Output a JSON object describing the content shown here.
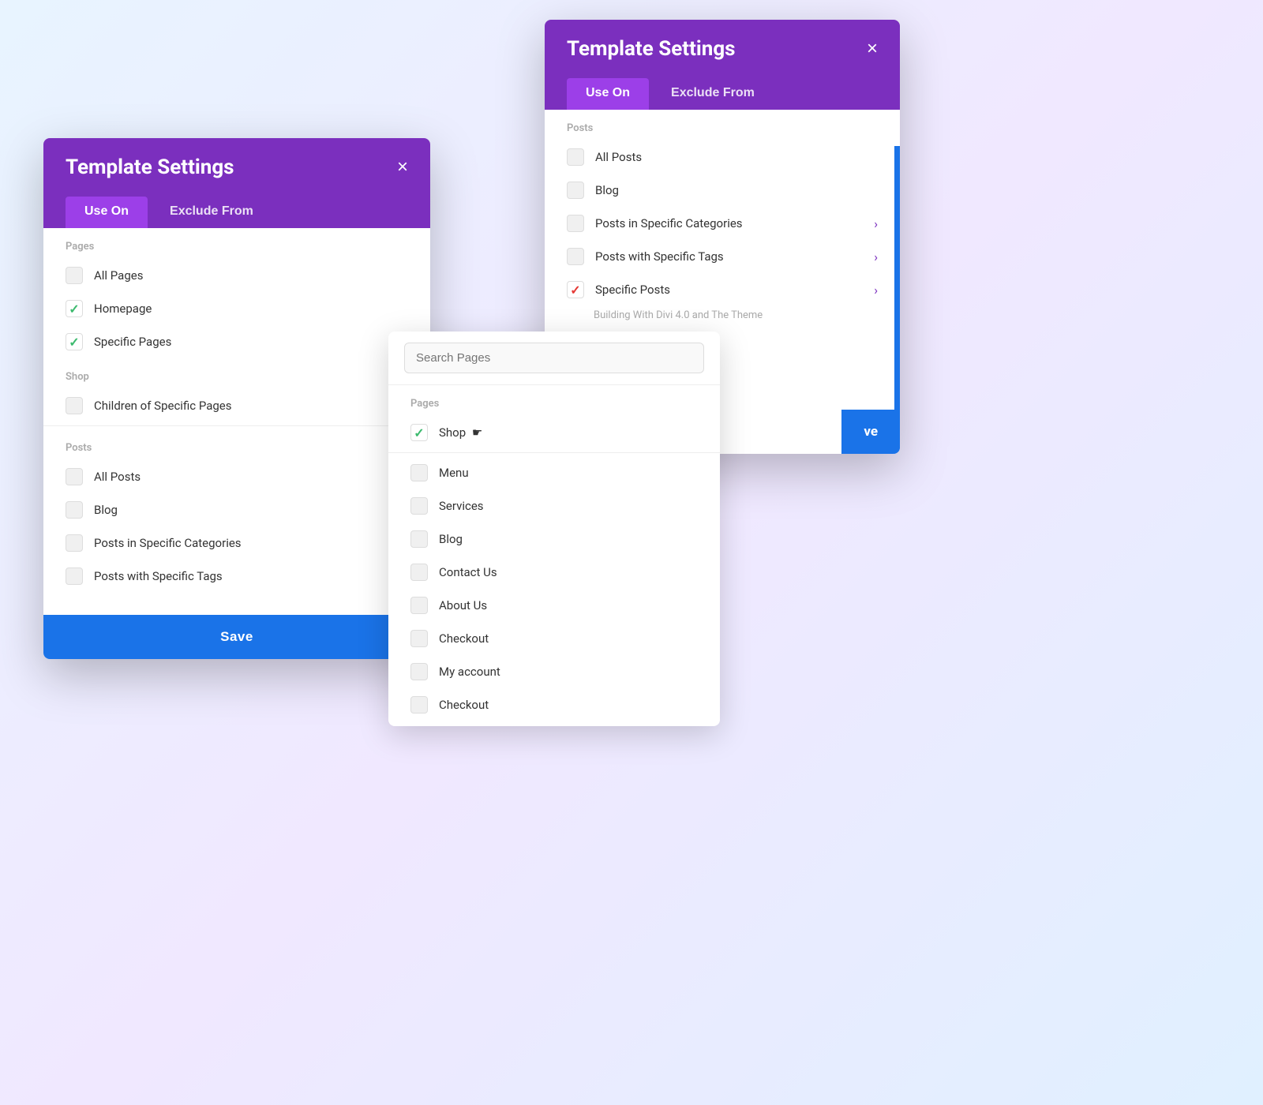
{
  "modal1": {
    "title": "Template Settings",
    "close": "×",
    "tabs": [
      {
        "id": "use-on",
        "label": "Use On",
        "active": true
      },
      {
        "id": "exclude-from",
        "label": "Exclude From",
        "active": false
      }
    ],
    "sections": [
      {
        "label": "Pages",
        "items": [
          {
            "id": "all-pages",
            "label": "All Pages",
            "checked": false,
            "arrow": false
          },
          {
            "id": "homepage",
            "label": "Homepage",
            "checked": true,
            "arrow": false
          },
          {
            "id": "specific-pages",
            "label": "Specific Pages",
            "checked": true,
            "arrow": true
          }
        ]
      },
      {
        "label": "Shop",
        "items": [
          {
            "id": "children-specific-pages",
            "label": "Children of Specific Pages",
            "checked": false,
            "arrow": true
          }
        ]
      },
      {
        "label": "Posts",
        "items": [
          {
            "id": "all-posts",
            "label": "All Posts",
            "checked": false,
            "arrow": false
          },
          {
            "id": "blog",
            "label": "Blog",
            "checked": false,
            "arrow": false
          },
          {
            "id": "posts-specific-categories",
            "label": "Posts in Specific Categories",
            "checked": false,
            "arrow": true
          },
          {
            "id": "posts-specific-tags",
            "label": "Posts with Specific Tags",
            "checked": false,
            "arrow": true
          }
        ]
      }
    ],
    "save_label": "Save"
  },
  "modal2": {
    "title": "Template Settings",
    "close": "×",
    "tabs": [
      {
        "id": "use-on",
        "label": "Use On",
        "active": true
      },
      {
        "id": "exclude-from",
        "label": "Exclude From",
        "active": false
      }
    ],
    "sections": [
      {
        "label": "Posts",
        "items": [
          {
            "id": "all-posts",
            "label": "All Posts",
            "checked": false,
            "red": false,
            "arrow": false
          },
          {
            "id": "blog",
            "label": "Blog",
            "checked": false,
            "red": false,
            "arrow": false
          },
          {
            "id": "posts-specific-categories",
            "label": "Posts in Specific Categories",
            "checked": false,
            "red": false,
            "arrow": true
          },
          {
            "id": "posts-specific-tags",
            "label": "Posts with Specific Tags",
            "checked": false,
            "red": false,
            "arrow": true
          },
          {
            "id": "specific-posts",
            "label": "Specific Posts",
            "checked": true,
            "red": true,
            "arrow": true
          }
        ]
      }
    ],
    "building_note": "Building With Divi 4.0 and The Theme",
    "save_label": "ve"
  },
  "modal3": {
    "search_placeholder": "Search Pages",
    "sections": [
      {
        "label": "Pages",
        "items": [
          {
            "id": "shop",
            "label": "Shop",
            "checked": true
          }
        ]
      },
      {
        "label": "",
        "items": [
          {
            "id": "menu",
            "label": "Menu",
            "checked": false
          },
          {
            "id": "services",
            "label": "Services",
            "checked": false
          },
          {
            "id": "blog",
            "label": "Blog",
            "checked": false
          },
          {
            "id": "contact-us",
            "label": "Contact Us",
            "checked": false
          },
          {
            "id": "about-us",
            "label": "About Us",
            "checked": false
          },
          {
            "id": "checkout",
            "label": "Checkout",
            "checked": false
          },
          {
            "id": "my-account",
            "label": "My account",
            "checked": false
          },
          {
            "id": "checkout2",
            "label": "Checkout",
            "checked": false
          }
        ]
      }
    ]
  }
}
